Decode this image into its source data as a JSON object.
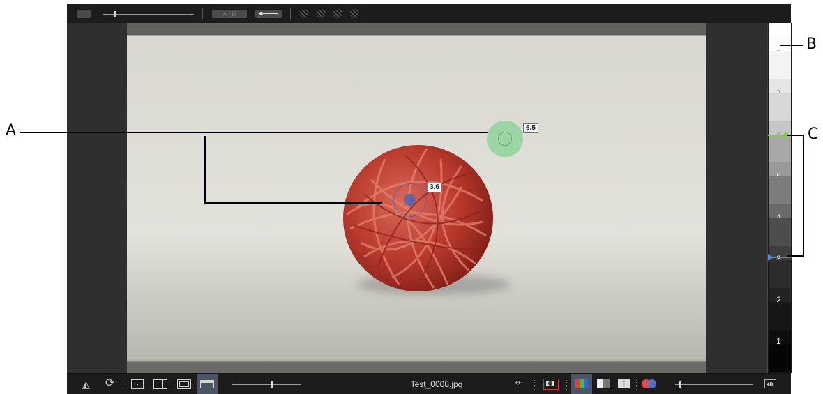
{
  "file": {
    "name": "Test_0008.jpg"
  },
  "samples": [
    {
      "value": "6.5",
      "color": "#7fd28e"
    },
    {
      "value": "3.6",
      "color": "#4d63b0"
    }
  ],
  "zones": {
    "labels": [
      "8",
      "7",
      "6",
      "5",
      "4",
      "3",
      "2",
      "1"
    ],
    "marker_green": "#7bd43a",
    "marker_blue": "#3f86ff"
  },
  "callouts": {
    "a": "A",
    "b": "B",
    "c": "C"
  },
  "toolbar_top": {
    "ab_label": "A / B"
  },
  "toolbar_bottom": {
    "icons": [
      "mirror-icon",
      "rotate-icon",
      "focus-frame-icon",
      "grid-icon",
      "single-view-icon",
      "filmstrip-icon",
      "crosshair-icon",
      "camera-icon",
      "rgb-channels-icon",
      "grayscale-icon",
      "exposure-warning-icon",
      "color-overlap-icon",
      "fit-width-icon"
    ]
  }
}
